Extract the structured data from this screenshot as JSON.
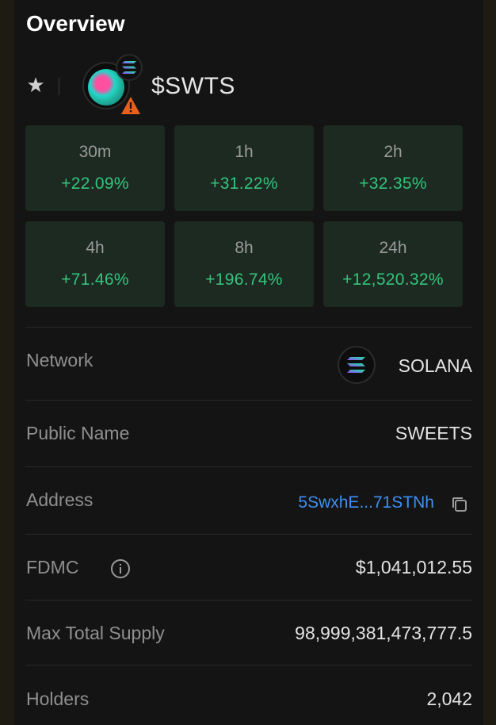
{
  "header": {
    "title": "Overview"
  },
  "token": {
    "symbol": "$SWTS",
    "chain_badge_icon": "solana-icon",
    "warning_icon": "warning-icon"
  },
  "changes": [
    {
      "period": "30m",
      "change": "+22.09%"
    },
    {
      "period": "1h",
      "change": "+31.22%"
    },
    {
      "period": "2h",
      "change": "+32.35%"
    },
    {
      "period": "4h",
      "change": "+71.46%"
    },
    {
      "period": "8h",
      "change": "+196.74%"
    },
    {
      "period": "24h",
      "change": "+12,520.32%"
    }
  ],
  "details": {
    "network": {
      "label": "Network",
      "value": "SOLANA"
    },
    "public_name": {
      "label": "Public Name",
      "value": "SWEETS"
    },
    "address": {
      "label": "Address",
      "value": "5SwxhE...71STNh"
    },
    "fdmc": {
      "label": "FDMC",
      "value": "$1,041,012.55"
    },
    "max_supply": {
      "label": "Max Total Supply",
      "value": "98,999,381,473,777.5"
    },
    "holders": {
      "label": "Holders",
      "value": "2,042"
    }
  },
  "colors": {
    "positive": "#35c47c",
    "link": "#3f8ff0",
    "tile_bg": "#1c2a22",
    "panel_bg": "#141414",
    "warning": "#e8601c"
  }
}
